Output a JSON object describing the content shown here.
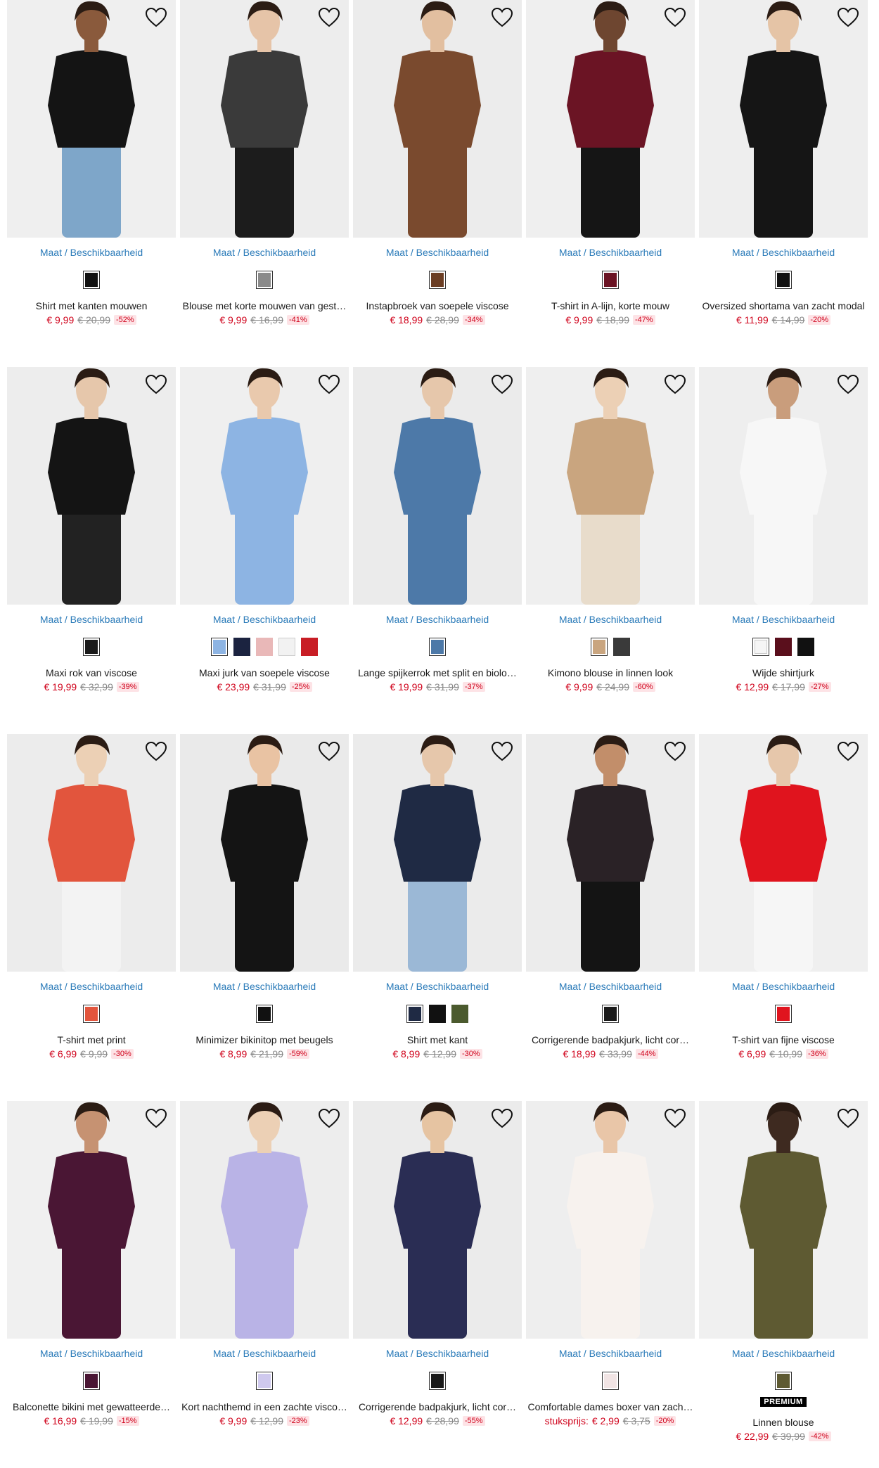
{
  "size_link_label": "Maat / Beschikbaarheid",
  "products": [
    {
      "name": "Shirt met kanten mouwen",
      "price": "€ 9,99",
      "old": "€ 20,99",
      "disc": "-52%",
      "bg": "#efefef",
      "garment": "#141414",
      "skin": "#8a5a3c",
      "lower": "#7ea6c9",
      "swatches": [
        "#111111"
      ]
    },
    {
      "name": "Blouse met korte mouwen van gest…",
      "price": "€ 9,99",
      "old": "€ 16,99",
      "disc": "-41%",
      "bg": "#ededed",
      "garment": "#3a3a3a",
      "skin": "#e6c4a8",
      "lower": "#1c1c1c",
      "swatches": [
        "#8a8a8a"
      ]
    },
    {
      "name": "Instapbroek van soepele viscose",
      "price": "€ 18,99",
      "old": "€ 28,99",
      "disc": "-34%",
      "bg": "#ececec",
      "garment": "#7a4a2e",
      "skin": "#e2bfa0",
      "lower": "#7a4a2e",
      "swatches": [
        "#6b3e24"
      ]
    },
    {
      "name": "T-shirt in A-lijn, korte mouw",
      "price": "€ 9,99",
      "old": "€ 18,99",
      "disc": "-47%",
      "bg": "#efefef",
      "garment": "#6b1424",
      "skin": "#6e4630",
      "lower": "#151515",
      "swatches": [
        "#6b1424"
      ]
    },
    {
      "name": "Oversized shortama van zacht modal",
      "price": "€ 11,99",
      "old": "€ 14,99",
      "disc": "-20%",
      "bg": "#eeeeee",
      "garment": "#151515",
      "skin": "#e5c4a6",
      "lower": "#151515",
      "swatches": [
        "#111111"
      ]
    },
    {
      "name": "Maxi rok van viscose",
      "price": "€ 19,99",
      "old": "€ 32,99",
      "disc": "-39%",
      "bg": "#ededed",
      "garment": "#141414",
      "skin": "#e6c7ab",
      "lower": "#222222",
      "swatches": [
        "#1a1a1a"
      ]
    },
    {
      "name": "Maxi jurk van soepele viscose",
      "price": "€ 23,99",
      "old": "€ 31,99",
      "disc": "-25%",
      "bg": "#efefef",
      "garment": "#8db4e3",
      "skin": "#e9c9ad",
      "lower": "#8db4e3",
      "swatches": [
        "#8db4e3",
        "#1b2340",
        "#e9b8b8",
        "#f2f2f2",
        "#c81d25"
      ]
    },
    {
      "name": "Lange spijkerrok met split en biolo…",
      "price": "€ 19,99",
      "old": "€ 31,99",
      "disc": "-37%",
      "bg": "#ebebeb",
      "garment": "#4d79a8",
      "skin": "#e6c7ab",
      "lower": "#4d79a8",
      "swatches": [
        "#4d79a8"
      ]
    },
    {
      "name": "Kimono blouse in linnen look",
      "price": "€ 9,99",
      "old": "€ 24,99",
      "disc": "-60%",
      "bg": "#efefef",
      "garment": "#c9a57f",
      "skin": "#ecd0b5",
      "lower": "#e8dccb",
      "swatches": [
        "#c9a57f",
        "#3a3a3a"
      ]
    },
    {
      "name": "Wijde shirtjurk",
      "price": "€ 12,99",
      "old": "€ 17,99",
      "disc": "-27%",
      "bg": "#eeeeee",
      "garment": "#f7f7f7",
      "skin": "#c99d7c",
      "lower": "#f7f7f7",
      "swatches": [
        "#f5f5f5",
        "#5a0f1c",
        "#111111"
      ]
    },
    {
      "name": "T-shirt met print",
      "price": "€ 6,99",
      "old": "€ 9,99",
      "disc": "-30%",
      "bg": "#ececec",
      "garment": "#e2553d",
      "skin": "#ecd0b5",
      "lower": "#f3f3f3",
      "swatches": [
        "#e2553d"
      ]
    },
    {
      "name": "Minimizer bikinitop met beugels",
      "price": "€ 8,99",
      "old": "€ 21,99",
      "disc": "-59%",
      "bg": "#eaeaea",
      "garment": "#141414",
      "skin": "#e9c3a3",
      "lower": "#141414",
      "swatches": [
        "#111111"
      ]
    },
    {
      "name": "Shirt met kant",
      "price": "€ 8,99",
      "old": "€ 12,99",
      "disc": "-30%",
      "bg": "#ebebeb",
      "garment": "#1f2a44",
      "skin": "#e6c7ab",
      "lower": "#9bb8d6",
      "swatches": [
        "#1f2a44",
        "#111111",
        "#4b5a2e"
      ]
    },
    {
      "name": "Corrigerende badpakjurk, licht cor…",
      "price": "€ 18,99",
      "old": "€ 33,99",
      "disc": "-44%",
      "bg": "#ececec",
      "garment": "#2a2226",
      "skin": "#c28e6a",
      "lower": "#141414",
      "swatches": [
        "#1a1a1a"
      ]
    },
    {
      "name": "T-shirt van fijne viscose",
      "price": "€ 6,99",
      "old": "€ 10,99",
      "disc": "-36%",
      "bg": "#efefef",
      "garment": "#e0141e",
      "skin": "#e6c7ab",
      "lower": "#f6f6f6",
      "swatches": [
        "#e0141e"
      ]
    },
    {
      "name": "Balconette bikini met gewatteerde…",
      "price": "€ 16,99",
      "old": "€ 19,99",
      "disc": "-15%",
      "bg": "#f0f0f0",
      "garment": "#4a1634",
      "skin": "#c69272",
      "lower": "#4a1634",
      "swatches": [
        "#4a1634"
      ]
    },
    {
      "name": "Kort nachthemd in een zachte visco…",
      "price": "€ 9,99",
      "old": "€ 12,99",
      "disc": "-23%",
      "bg": "#ededed",
      "garment": "#b9b3e6",
      "skin": "#ecd0b5",
      "lower": "#b9b3e6",
      "swatches": [
        "#cfc9ee"
      ]
    },
    {
      "name": "Corrigerende badpakjurk, licht cor…",
      "price": "€ 12,99",
      "old": "€ 28,99",
      "disc": "-55%",
      "bg": "#ebebeb",
      "garment": "#2a2d54",
      "skin": "#e6c4a2",
      "lower": "#2a2d54",
      "swatches": [
        "#1a1a1a"
      ]
    },
    {
      "name": "Comfortable dames boxer van zach…",
      "unit_label": "stuksprijs:",
      "price": "€ 2,99",
      "old": "€ 3,75",
      "disc": "-20%",
      "bg": "#eeeeee",
      "garment": "#f7f2ee",
      "skin": "#e9c6a8",
      "lower": "#f7f2ee",
      "swatches": [
        "#f1e4e4"
      ]
    },
    {
      "name": "Linnen blouse",
      "premium": "PREMIUM",
      "price": "€ 22,99",
      "old": "€ 39,99",
      "disc": "-42%",
      "bg": "#f0f0f0",
      "garment": "#5e5a32",
      "skin": "#3e2a20",
      "lower": "#5e5a32",
      "swatches": [
        "#5e5a32"
      ]
    }
  ]
}
